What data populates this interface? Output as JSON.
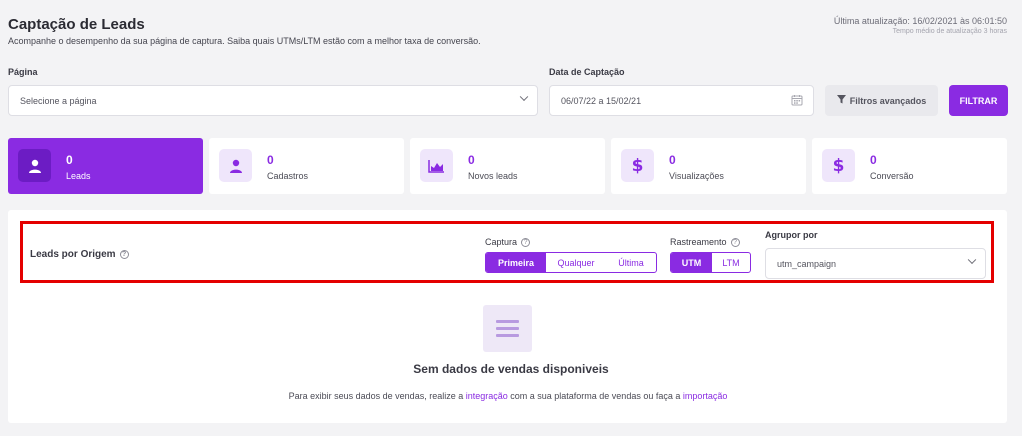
{
  "header": {
    "title": "Captação de Leads",
    "subtitle": "Acompanhe o desempenho da sua página de captura. Saiba quais UTMs/LTM estão com a melhor taxa de conversão.",
    "last_update": "Última atualização: 16/02/2021 às 06:01:50",
    "avg_update_time": "Tempo médio de atualização 3 horas"
  },
  "filters": {
    "page_label": "Página",
    "page_placeholder": "Selecione a página",
    "date_label": "Data de Captação",
    "date_value": "06/07/22 a 15/02/21",
    "advanced_label": "Filtros avançados",
    "filter_button": "FILTRAR"
  },
  "cards": [
    {
      "value": "0",
      "label": "Leads",
      "icon": "user-icon",
      "active": true
    },
    {
      "value": "0",
      "label": "Cadastros",
      "icon": "user-icon"
    },
    {
      "value": "0",
      "label": "Novos leads",
      "icon": "area-chart-icon"
    },
    {
      "value": "0",
      "label": "Visualizações",
      "icon": "dollar-icon"
    },
    {
      "value": "0",
      "label": "Conversão",
      "icon": "dollar-icon"
    }
  ],
  "origin": {
    "title": "Leads por Origem",
    "capture_label": "Captura",
    "capture_options": [
      "Primeira",
      "Qualquer",
      "Última"
    ],
    "capture_selected": "Primeira",
    "tracking_label": "Rastreamento",
    "tracking_options": [
      "UTM",
      "LTM"
    ],
    "tracking_selected": "UTM",
    "group_label": "Agrupor por",
    "group_value": "utm_campaign"
  },
  "empty": {
    "title": "Sem dados de vendas disponiveis",
    "desc_pre": "Para exibir seus dados de vendas, realize a ",
    "link1": "integração",
    "desc_mid": " com a sua plataforma de vendas ou faça a ",
    "link2": "importação"
  },
  "colors": {
    "accent": "#8a2be2",
    "highlight": "#e40000"
  }
}
